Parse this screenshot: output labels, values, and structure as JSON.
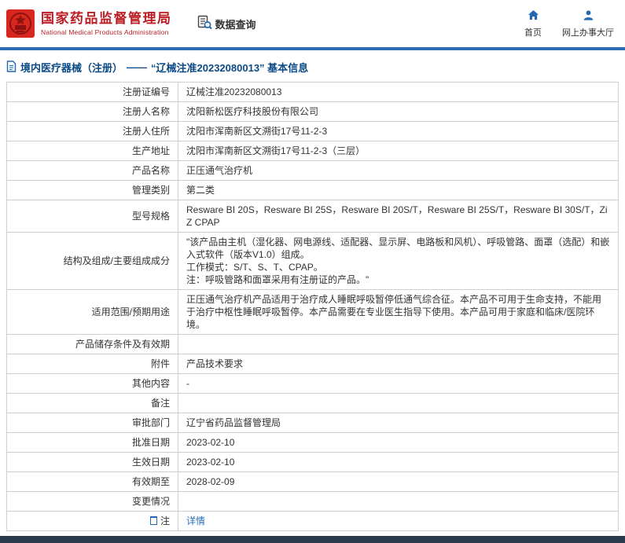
{
  "header": {
    "title": "国家药品监督管理局",
    "subtitle": "National Medical Products Administration",
    "section_label": "数据查询",
    "nav": [
      {
        "label": "首页"
      },
      {
        "label": "网上办事大厅"
      }
    ]
  },
  "page_title": {
    "prefix": "境内医疗器械（注册）",
    "dash": "——",
    "name": "“辽械注准20232080013” 基本信息"
  },
  "colors": {
    "brand_red": "#bb1d24",
    "accent_blue": "#2e6db4",
    "link_blue": "#2a6fb8",
    "footer_dark": "#2c3a4d"
  },
  "table": {
    "rows": [
      {
        "label": "注册证编号",
        "value": "辽械注准20232080013"
      },
      {
        "label": "注册人名称",
        "value": "沈阳新松医疗科技股份有限公司"
      },
      {
        "label": "注册人住所",
        "value": "沈阳市浑南新区文溯街17号11-2-3"
      },
      {
        "label": "生产地址",
        "value": "沈阳市浑南新区文溯街17号11-2-3（三层）"
      },
      {
        "label": "产品名称",
        "value": "正压通气治疗机"
      },
      {
        "label": "管理类别",
        "value": "第二类"
      },
      {
        "label": "型号规格",
        "value": "Resware BI 20S，Resware BI 25S，Resware BI 20S/T，Resware BI 25S/T，Resware BI 30S/T，ZiZ CPAP"
      },
      {
        "label": "结构及组成/主要组成成分",
        "value": "\"该产品由主机（湿化器、网电源线、适配器、显示屏、电路板和风机）、呼吸管路、面罩（选配）和嵌入式软件（版本V1.0）组成。\n工作模式：S/T、S、T、CPAP。\n注：呼吸管路和面罩采用有注册证的产品。\""
      },
      {
        "label": "适用范围/预期用途",
        "value": "正压通气治疗机产品适用于治疗成人睡眠呼吸暂停低通气综合征。本产品不可用于生命支持，不能用于治疗中枢性睡眠呼吸暂停。本产品需要在专业医生指导下使用。本产品可用于家庭和临床/医院环境。"
      },
      {
        "label": "产品储存条件及有效期",
        "value": ""
      },
      {
        "label": "附件",
        "value": "产品技术要求"
      },
      {
        "label": "其他内容",
        "value": "-"
      },
      {
        "label": "备注",
        "value": ""
      },
      {
        "label": "审批部门",
        "value": "辽宁省药品监督管理局"
      },
      {
        "label": "批准日期",
        "value": "2023-02-10"
      },
      {
        "label": "生效日期",
        "value": "2023-02-10"
      },
      {
        "label": "有效期至",
        "value": "2028-02-09"
      },
      {
        "label": "变更情况",
        "value": ""
      },
      {
        "label": "注",
        "icon": "note-icon",
        "value": "详情",
        "link": true
      }
    ]
  }
}
